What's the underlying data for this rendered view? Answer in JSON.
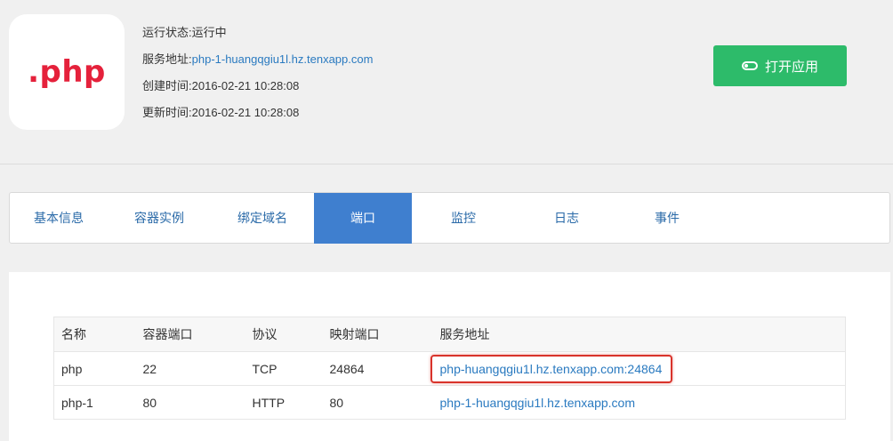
{
  "app": {
    "logo_text": ".php",
    "status_label": "运行状态:",
    "status_value": "运行中",
    "address_label": "服务地址:",
    "address_value": "php-1-huangqgiu1l.hz.tenxapp.com",
    "created_label": "创建时间:",
    "created_value": "2016-02-21 10:28:08",
    "updated_label": "更新时间:",
    "updated_value": "2016-02-21 10:28:08",
    "open_button_label": "打开应用",
    "open_button_color": "#2dbb6a"
  },
  "tabs": [
    {
      "label": "基本信息"
    },
    {
      "label": "容器实例"
    },
    {
      "label": "绑定域名"
    },
    {
      "label": "端口",
      "active": true
    },
    {
      "label": "监控"
    },
    {
      "label": "日志"
    },
    {
      "label": "事件"
    }
  ],
  "ports_table": {
    "headers": [
      "名称",
      "容器端口",
      "协议",
      "映射端口",
      "服务地址"
    ],
    "rows": [
      {
        "name": "php",
        "container_port": "22",
        "protocol": "TCP",
        "mapped_port": "24864",
        "address": "php-huangqgiu1l.hz.tenxapp.com:24864",
        "highlighted": true
      },
      {
        "name": "php-1",
        "container_port": "80",
        "protocol": "HTTP",
        "mapped_port": "80",
        "address": "php-1-huangqgiu1l.hz.tenxapp.com"
      }
    ]
  },
  "colors": {
    "active_tab": "#3f7fcf",
    "link": "#2a7ac0",
    "highlight_border": "#d9332b",
    "logo": "#e5213b"
  }
}
